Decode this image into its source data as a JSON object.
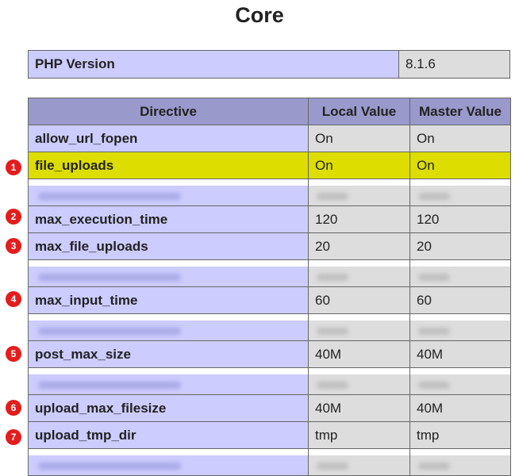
{
  "title": "Core",
  "version": {
    "label": "PHP Version",
    "value": "8.1.6"
  },
  "headers": {
    "directive": "Directive",
    "local": "Local Value",
    "master": "Master Value"
  },
  "rows": [
    {
      "name": "allow_url_fopen",
      "local": "On",
      "master": "On"
    },
    {
      "name": "file_uploads",
      "local": "On",
      "master": "On",
      "highlighted": true
    },
    {
      "name": "max_execution_time",
      "local": "120",
      "master": "120"
    },
    {
      "name": "max_file_uploads",
      "local": "20",
      "master": "20"
    },
    {
      "name": "max_input_time",
      "local": "60",
      "master": "60"
    },
    {
      "name": "post_max_size",
      "local": "40M",
      "master": "40M"
    },
    {
      "name": "upload_max_filesize",
      "local": "40M",
      "master": "40M"
    },
    {
      "name": "upload_tmp_dir",
      "local": "tmp",
      "master": "tmp"
    }
  ],
  "markers": [
    "1",
    "2",
    "3",
    "4",
    "5",
    "6",
    "7"
  ],
  "colors": {
    "header": "#9999cc",
    "directive": "#ccccff",
    "value": "#dddddd",
    "highlight": "#dddd00",
    "marker": "#e31d1d"
  }
}
